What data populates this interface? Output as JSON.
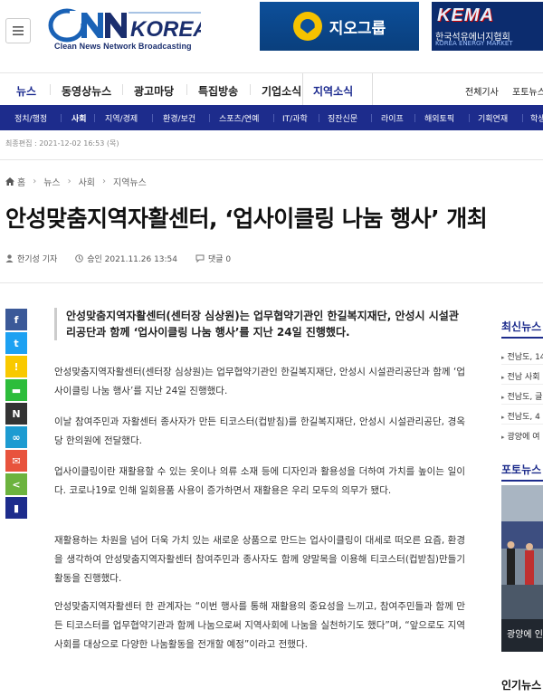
{
  "header": {
    "logo_text": "CNN KOREA",
    "logo_tagline": "Clean News Network Broadcasting",
    "ad1_text": "지오그룹",
    "ad2_title": "KEMA",
    "ad2_sub": "한국석유에너지협회",
    "ad2_sub2": "KOREA ENERGY MARKET"
  },
  "main_nav": {
    "items": [
      "뉴스",
      "동영상뉴스",
      "광고마당",
      "특집방송",
      "기업소식",
      "지역소식"
    ],
    "active": "지역소식",
    "right_items": [
      "전체기사",
      "포토뉴스"
    ]
  },
  "sub_nav": {
    "items": [
      "정치/행정",
      "사회",
      "지역/경제",
      "환경/보건",
      "스포츠/연예",
      "IT/과학",
      "징잔신문",
      "라이프",
      "해외토픽",
      "기획연재",
      "학생"
    ],
    "active": "사회"
  },
  "updated": "최종편집 : 2021-12-02 16:53 (목)",
  "breadcrumb": {
    "home": "홈",
    "items": [
      "뉴스",
      "사회",
      "지역뉴스"
    ]
  },
  "article": {
    "title": "안성맞춤지역자활센터, ‘업사이클링 나눔 행사’ 개최",
    "author": "한기성 기자",
    "approved": "승인 2021.11.26 13:54",
    "comments": "댓글 0",
    "lead": "안성맞춤지역자활센터(센터장 심상원)는 업무협약기관인 한길복지재단, 안성시 시설관리공단과 함께 ‘업사이클링 나눔 행사’를 지난 24일 진행했다.",
    "paragraphs": [
      "안성맞춤지역자활센터(센터장 심상원)는 업무협약기관인 한길복지재단, 안성시 시설관리공단과 함께 ‘업사이클링 나눔 행사’를 지난 24일 진행했다.",
      "이날 참여주민과 자활센터 종사자가 만든 티코스터(컵받침)를 한길복지재단, 안성시 시설관리공단, 경옥당 한의원에 전달했다.",
      "업사이클링이란 재활용할 수 있는 옷이나 의류 소재 등에 디자인과 활용성을 더하여 가치를 높이는 일이다. 코로나19로 인해 일회용품 사용이 증가하면서 재활용은 우리 모두의 의무가 됐다.",
      "재활용하는 차원을 넘어 더욱 가치 있는 새로운 상품으로 만드는 업사이클링이 대세로 떠오른 요즘, 환경을 생각하여 안성맞춤지역자활센터 참여주민과 종사자도 함께 양말목을 이용해 티코스터(컵받침)만들기 활동을 진행했다.",
      "안성맞춤지역자활센터 한 관계자는 “이번 행사를 통해 재활용의 중요성을 느끼고, 참여주민들과 함께 만든 티코스터를 업무협약기관과 함께 나눔으로써 지역사회에 나눔을 실천하기도 했다”며, “앞으로도 지역사회를 대상으로 다양한 나눔활동을 전개할 예정”이라고 전했다."
    ]
  },
  "share": {
    "buttons": [
      {
        "name": "facebook",
        "glyph": "f",
        "color": "#3b5998"
      },
      {
        "name": "twitter",
        "glyph": "t",
        "color": "#1da1f2"
      },
      {
        "name": "kakaostory",
        "glyph": "!",
        "color": "#f9c900"
      },
      {
        "name": "band",
        "glyph": "▬",
        "color": "#2dbd3b"
      },
      {
        "name": "naver",
        "glyph": "N",
        "color": "#333333"
      },
      {
        "name": "link",
        "glyph": "∞",
        "color": "#1d9bd1"
      },
      {
        "name": "email",
        "glyph": "✉",
        "color": "#e8533d"
      },
      {
        "name": "share",
        "glyph": "<",
        "color": "#6cb33e"
      },
      {
        "name": "bookmark",
        "glyph": "▮",
        "color": "#1d2c8c"
      }
    ]
  },
  "sidebar": {
    "latest_head": "최신뉴스",
    "latest_items": [
      "전남도, 14",
      "전남 사회",
      "전남도, 글",
      "전남도, 4",
      "광양에 여"
    ],
    "photo_head": "포토뉴스",
    "photo_caption": "광양에 인",
    "popular_head": "인기뉴스"
  },
  "colors": {
    "brand_navy": "#1d2c8c",
    "text": "#222222"
  }
}
